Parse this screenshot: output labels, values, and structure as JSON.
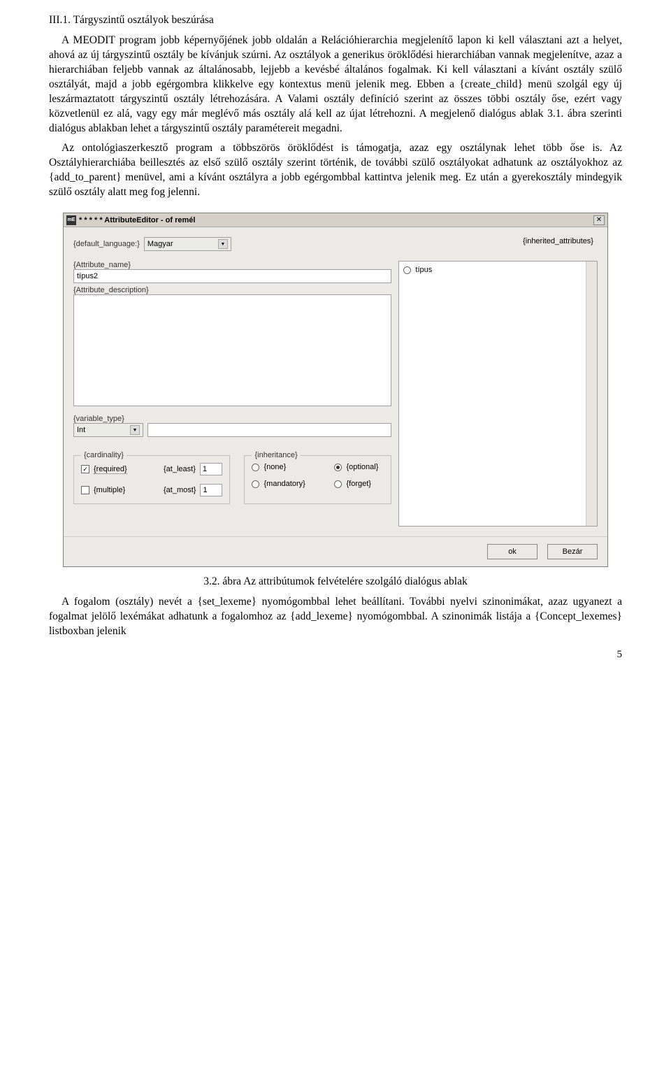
{
  "doc": {
    "heading": "III.1. Tárgyszintű osztályok beszúrása",
    "para1": "A MEODIT program jobb képernyőjének jobb oldalán a Relációhierarchia megjelenítő lapon ki kell választani azt a helyet, ahová az új tárgyszintű osztály be kívánjuk szúrni. Az osztályok a generikus öröklődési hierarchiában vannak megjelenítve, azaz a hierarchiában feljebb vannak az általánosabb, lejjebb a kevésbé általános fogalmak. Ki kell választani a kívánt osztály szülő osztályát, majd a jobb egérgombra klikkelve egy kontextus menü jelenik meg. Ebben a {create_child} menü szolgál egy új leszármaztatott tárgyszintű osztály létrehozására. A Valami osztály definíció szerint az összes többi osztály őse, ezért vagy közvetlenül ez alá, vagy egy már meglévő más osztály alá kell az újat létrehozni. A megjelenő dialógus ablak 3.1. ábra szerinti dialógus ablakban lehet a tárgyszintű osztály paramétereit megadni.",
    "para2": "Az ontológiaszerkesztő program a többszörös öröklődést is támogatja, azaz egy osztálynak lehet több őse is. Az Osztályhierarchiába beillesztés az első szülő osztály szerint történik, de további szülő osztályokat adhatunk az osztályokhoz az {add_to_parent} menüvel, ami a kívánt osztályra a jobb egérgombbal kattintva jelenik meg. Ez után a gyerekosztály mindegyik szülő osztály alatt meg fog jelenni.",
    "caption": "3.2. ábra Az attribútumok felvételére szolgáló dialógus ablak",
    "para3": "A fogalom (osztály) nevét a {set_lexeme} nyomógombbal lehet beállítani. További nyelvi szinonimákat, azaz ugyanezt a fogalmat jelölő lexémákat adhatunk a fogalomhoz az {add_lexeme} nyomógombbal. A szinonimák listája a {Concept_lexemes} listboxban jelenik",
    "page": "5"
  },
  "dialog": {
    "title": "* * * * * AttributeEditor - of remél",
    "default_language_label": "{default_language:}",
    "default_language_value": "Magyar",
    "inherited_attributes_label": "{inherited_attributes}",
    "attribute_name_label": "{Attribute_name}",
    "attribute_name_value": "típus2",
    "attribute_description_label": "{Attribute_description}",
    "variable_type_label": "{variable_type}",
    "variable_type_value": "Int",
    "cardinality_legend": "{cardinality}",
    "required_label": "{required}",
    "at_least_label": "{at_least}",
    "at_least_value": "1",
    "multiple_label": "{multiple}",
    "at_most_label": "{at_most}",
    "at_most_value": "1",
    "inheritance_legend": "{inheritance}",
    "none_label": "{none}",
    "optional_label": "{optional}",
    "mandatory_label": "{mandatory}",
    "forget_label": "{forget}",
    "list_item_0": "típus",
    "ok_label": "ok",
    "close_label": "Bezár"
  }
}
